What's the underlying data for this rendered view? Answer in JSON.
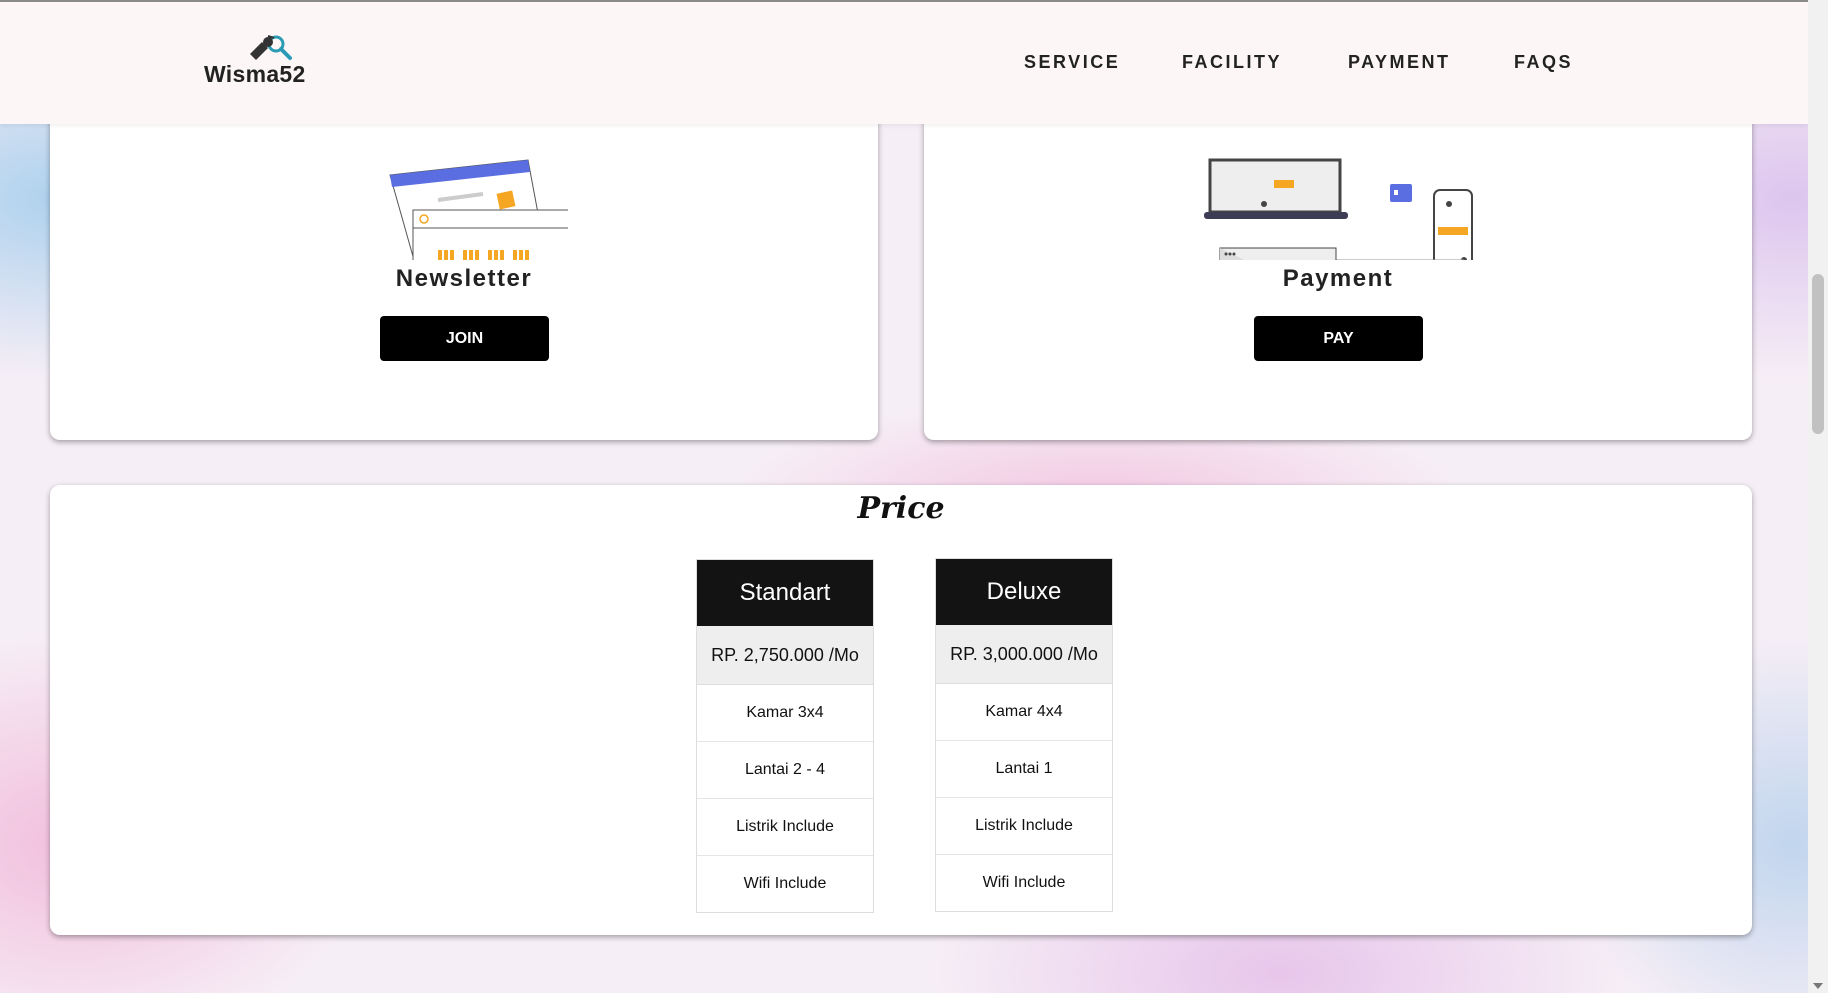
{
  "brand": {
    "name": "Wisma52"
  },
  "nav": {
    "items": [
      "SERVICE",
      "FACILITY",
      "PAYMENT",
      "FAQS"
    ]
  },
  "newsletter": {
    "title": "Newsletter",
    "button": "JOIN"
  },
  "payment": {
    "title": "Payment",
    "button": "PAY"
  },
  "price": {
    "title": "Price",
    "plans": [
      {
        "name": "Standart",
        "price": "RP. 2,750.000 /Mo",
        "features": [
          "Kamar 3x4",
          "Lantai 2 - 4",
          "Listrik Include",
          "Wifi Include"
        ]
      },
      {
        "name": "Deluxe",
        "price": "RP. 3,000.000 /Mo",
        "features": [
          "Kamar 4x4",
          "Lantai 1",
          "Listrik Include",
          "Wifi Include"
        ]
      }
    ]
  },
  "colors": {
    "accent_orange": "#f5a623",
    "accent_blue": "#5b6ee1",
    "button_bg": "#000000"
  }
}
